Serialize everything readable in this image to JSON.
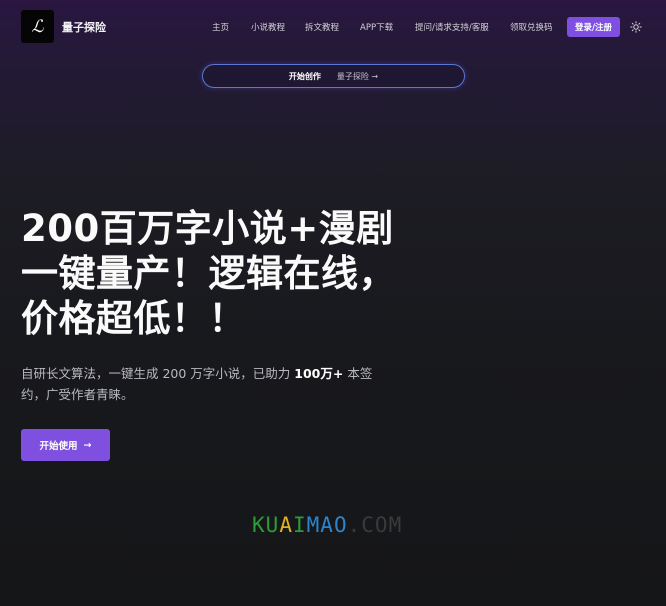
{
  "header": {
    "logo_glyph": "ℒ",
    "brand": "量子探险",
    "nav": [
      "主页",
      "小说教程",
      "拆文教程",
      "APP下载",
      "提问/请求支持/客服",
      "领取兑换码"
    ],
    "login_label": "登录/注册",
    "theme_icon": "sun-icon"
  },
  "announcement": {
    "primary": "开始创作",
    "secondary": "量子探险 →"
  },
  "hero": {
    "title_lines": [
      "200百万字小说+漫剧",
      "一键量产！逻辑在线，",
      "价格超低！！"
    ],
    "desc_part1": "自研长文算法，一键生成 200 万字小说，已助力 ",
    "desc_strong": "100万+",
    "desc_part2": " 本签约，广受作者青睐。",
    "cta_label": "开始使用",
    "cta_arrow": "→"
  },
  "watermark": {
    "letters": [
      "K",
      "U",
      "A",
      "I",
      "M",
      "A",
      "O",
      ".",
      "C",
      "O",
      "M"
    ],
    "colors": [
      "#2e9a3a",
      "#2e9a3a",
      "#e0b21e",
      "#2e9a3a",
      "#2f84c9",
      "#2f84c9",
      "#2f84c9",
      "#3a3a3a",
      "#3a3a3a",
      "#3a3a3a",
      "#3a3a3a"
    ]
  },
  "colors": {
    "accent": "#7e4fe0",
    "pill_border": "#5b78d6"
  }
}
